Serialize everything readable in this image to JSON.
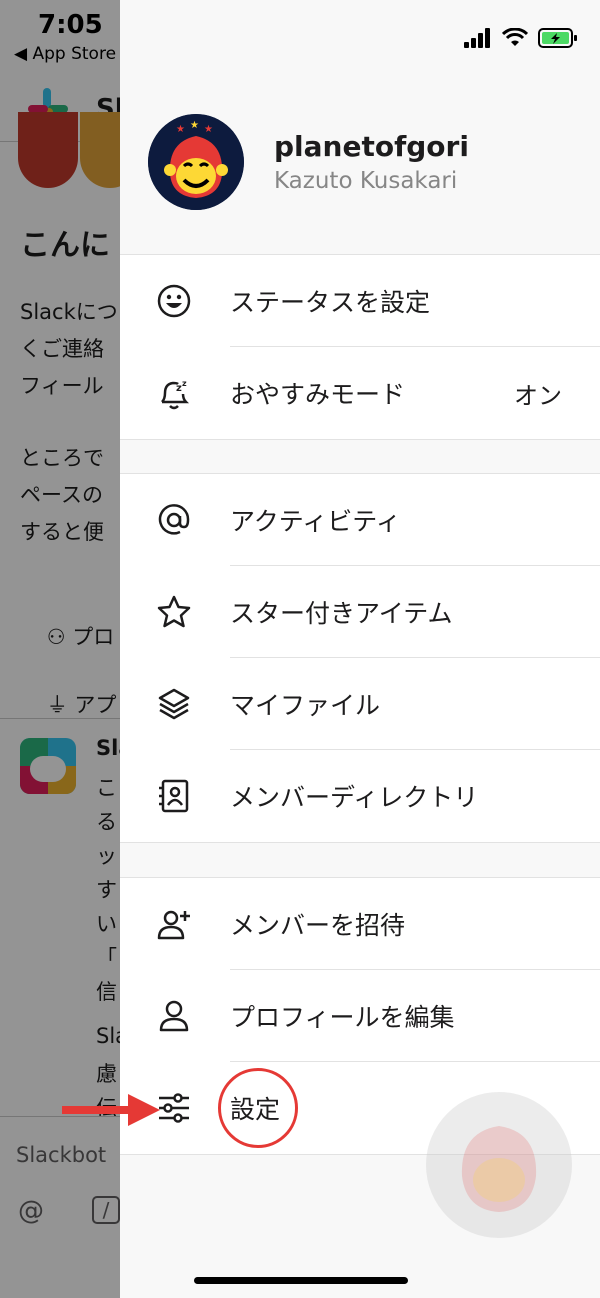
{
  "background": {
    "status_time": "7:05",
    "back_label": "◀ App Store",
    "app_title": "Sla",
    "heading": "こんに",
    "paragraph1": [
      "Slackにつ",
      "くご連絡",
      "フィール"
    ],
    "paragraph2": [
      "ところで",
      "ペースの",
      "すると便"
    ],
    "link_profile": "プロ",
    "link_app": "アプ",
    "bot_name": "Sla",
    "bot_lines": [
      "こ",
      "る",
      "ッ",
      "す",
      "い",
      "「",
      "信"
    ],
    "bot_lines2": [
      "Sla",
      "慮",
      "伝"
    ],
    "composer_placeholder": "Slackbot"
  },
  "drawer": {
    "profile": {
      "username": "planetofgori",
      "real_name": "Kazuto Kusakari"
    },
    "group1": [
      {
        "id": "status",
        "icon": "smiley-icon",
        "label": "ステータスを設定",
        "value": ""
      },
      {
        "id": "dnd",
        "icon": "snooze-bell-icon",
        "label": "おやすみモード",
        "value": "オン"
      }
    ],
    "group2": [
      {
        "id": "activity",
        "icon": "at-sign-icon",
        "label": "アクティビティ"
      },
      {
        "id": "starred",
        "icon": "star-icon",
        "label": "スター付きアイテム"
      },
      {
        "id": "files",
        "icon": "layers-icon",
        "label": "マイファイル"
      },
      {
        "id": "directory",
        "icon": "contact-card-icon",
        "label": "メンバーディレクトリ"
      }
    ],
    "group3": [
      {
        "id": "invite",
        "icon": "add-person-icon",
        "label": "メンバーを招待"
      },
      {
        "id": "edit_profile",
        "icon": "person-icon",
        "label": "プロフィールを編集"
      },
      {
        "id": "settings",
        "icon": "sliders-icon",
        "label": "設定"
      }
    ]
  },
  "colors": {
    "annotation_red": "#e53935",
    "text": "#1d1c1d",
    "subtext": "#868686",
    "battery_green": "#4cd964"
  }
}
